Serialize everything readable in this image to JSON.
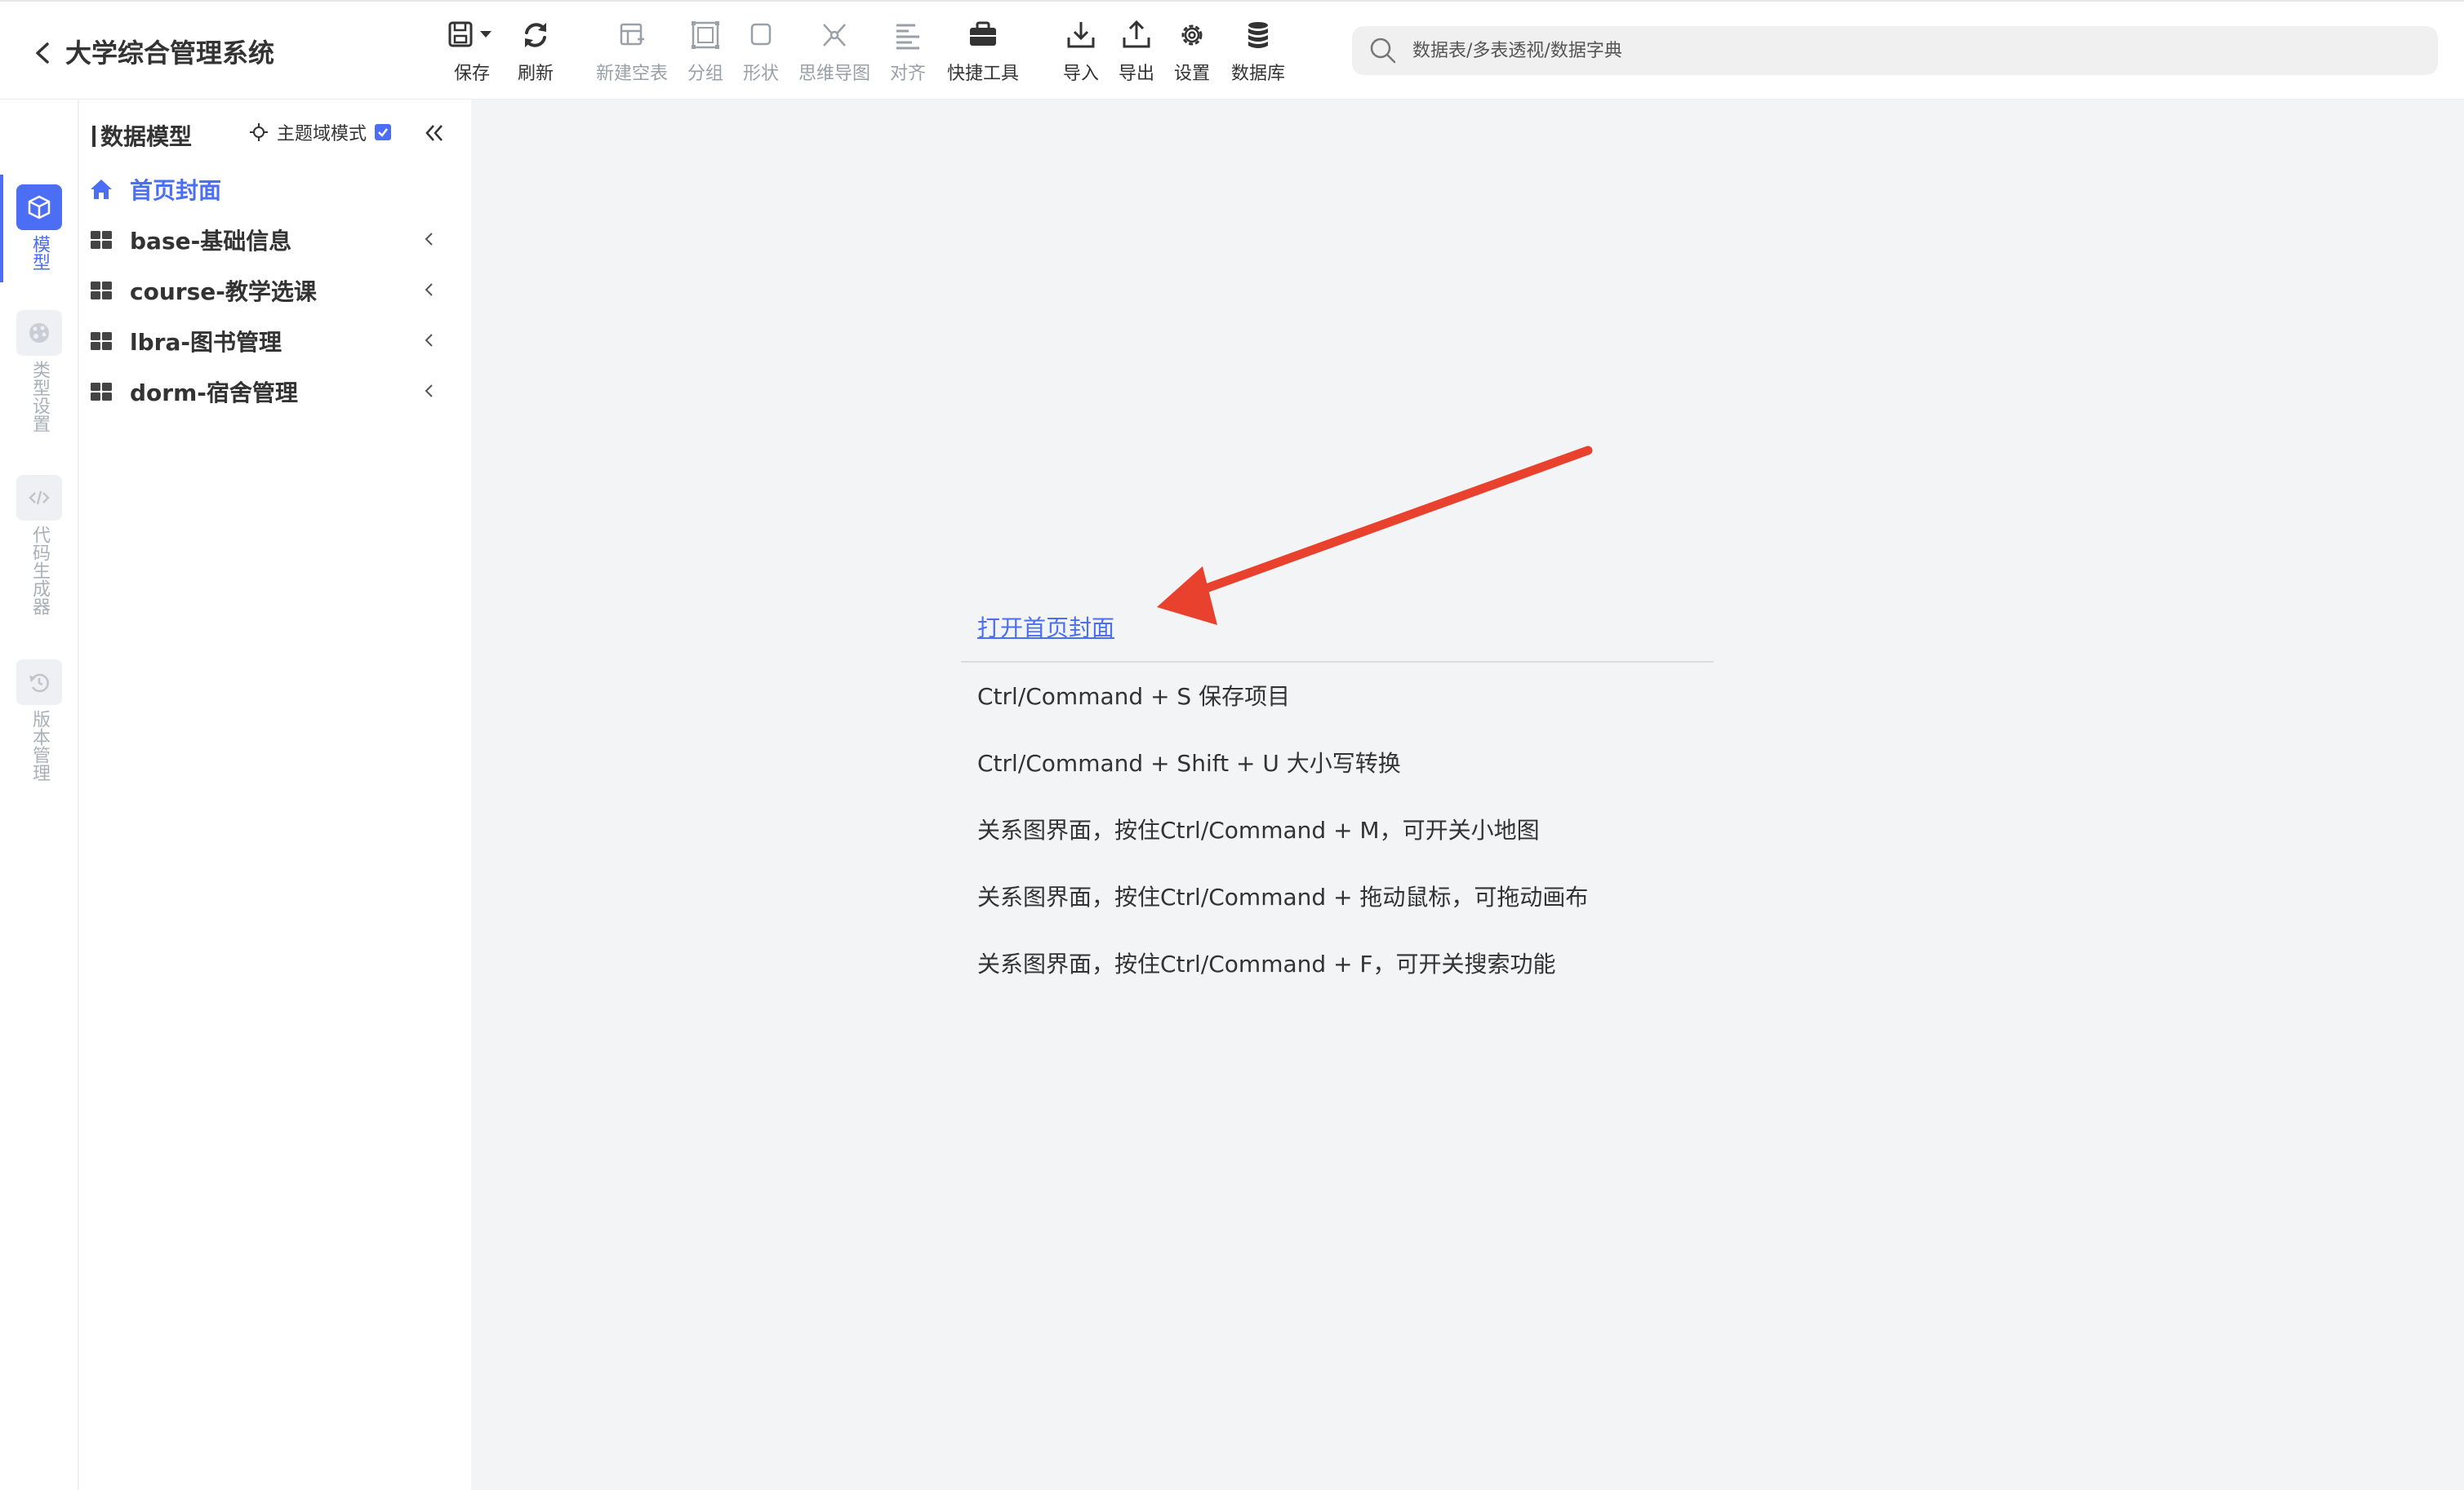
{
  "header": {
    "title": "大学综合管理系统",
    "toolbar": [
      {
        "label": "保存",
        "icon": "save-icon",
        "disabled": false
      },
      {
        "label": "刷新",
        "icon": "refresh-icon",
        "disabled": false
      },
      {
        "label": "新建空表",
        "icon": "new-table-icon",
        "disabled": true
      },
      {
        "label": "分组",
        "icon": "group-icon",
        "disabled": true
      },
      {
        "label": "形状",
        "icon": "shape-icon",
        "disabled": true
      },
      {
        "label": "思维导图",
        "icon": "mindmap-icon",
        "disabled": true
      },
      {
        "label": "对齐",
        "icon": "align-icon",
        "disabled": true
      },
      {
        "label": "快捷工具",
        "icon": "toolbox-icon",
        "disabled": false
      },
      {
        "label": "导入",
        "icon": "import-icon",
        "disabled": false
      },
      {
        "label": "导出",
        "icon": "export-icon",
        "disabled": false
      },
      {
        "label": "设置",
        "icon": "gear-icon",
        "disabled": false
      },
      {
        "label": "数据库",
        "icon": "database-icon",
        "disabled": false
      }
    ],
    "search": {
      "placeholder": "数据表/多表透视/数据字典",
      "value": ""
    }
  },
  "rail": {
    "items": [
      {
        "label": "模型",
        "icon": "cube-icon",
        "active": true
      },
      {
        "label": "类型设置",
        "icon": "palette-icon",
        "active": false
      },
      {
        "label": "代码生成器",
        "icon": "code-icon",
        "active": false
      },
      {
        "label": "版本管理",
        "icon": "history-icon",
        "active": false
      }
    ]
  },
  "sidebar": {
    "title": "数据模型",
    "domain_mode_label": "主题域模式",
    "domain_mode_checked": true,
    "tree": [
      {
        "label": "首页封面",
        "icon": "home-icon"
      },
      {
        "label": "base-基础信息",
        "icon": "grid-icon"
      },
      {
        "label": "course-教学选课",
        "icon": "grid-icon"
      },
      {
        "label": "lbra-图书管理",
        "icon": "grid-icon"
      },
      {
        "label": "dorm-宿舍管理",
        "icon": "grid-icon"
      }
    ]
  },
  "main": {
    "open_cover_link": "打开首页封面",
    "tips": [
      "Ctrl/Command + S 保存项目",
      "Ctrl/Command + Shift + U 大小写转换",
      "关系图界面，按住Ctrl/Command + M，可开关小地图",
      "关系图界面，按住Ctrl/Command + 拖动鼠标，可拖动画布",
      "关系图界面，按住Ctrl/Command + F，可开关搜索功能"
    ]
  },
  "colors": {
    "accent": "#4c6ef5",
    "annotation_arrow": "#e8412d",
    "disabled_text": "#9aa0a8"
  }
}
